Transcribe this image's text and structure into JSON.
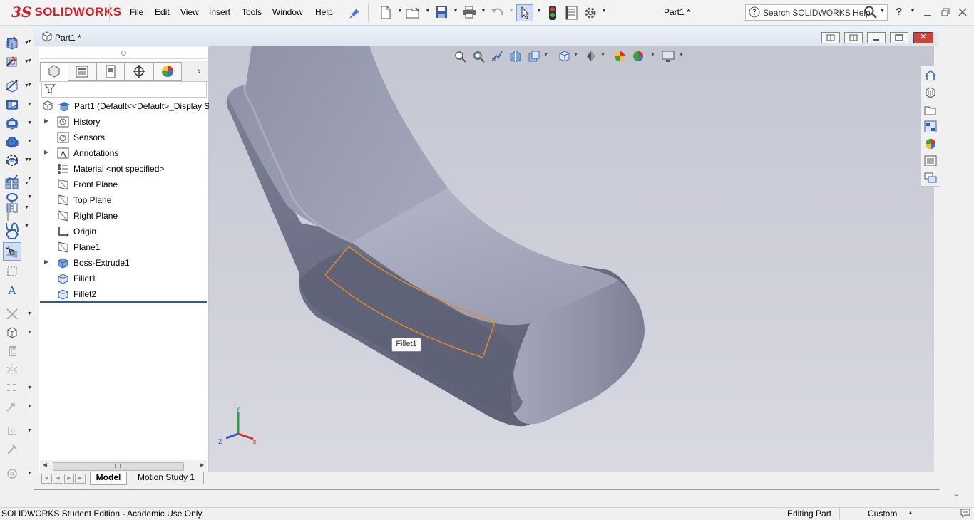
{
  "app": {
    "brand_ds": "3S",
    "brand_name": "SOLIDWORKS"
  },
  "menu": [
    "File",
    "Edit",
    "View",
    "Insert",
    "Tools",
    "Window",
    "Help"
  ],
  "document": {
    "title_top": "Part1 *",
    "window_title": "Part1 *"
  },
  "search": {
    "placeholder": "Search SOLIDWORKS Help"
  },
  "help_glyph": "?",
  "feature_tree": {
    "root": "Part1  (Default<<Default>_Display S",
    "items": [
      {
        "label": "History",
        "expandable": true,
        "icon": "history-icon"
      },
      {
        "label": "Sensors",
        "expandable": false,
        "icon": "sensor-icon"
      },
      {
        "label": "Annotations",
        "expandable": true,
        "icon": "annotation-icon"
      },
      {
        "label": "Material <not specified>",
        "expandable": false,
        "icon": "material-icon"
      },
      {
        "label": "Front Plane",
        "expandable": false,
        "icon": "plane-icon"
      },
      {
        "label": "Top Plane",
        "expandable": false,
        "icon": "plane-icon"
      },
      {
        "label": "Right Plane",
        "expandable": false,
        "icon": "plane-icon"
      },
      {
        "label": "Origin",
        "expandable": false,
        "icon": "origin-icon"
      },
      {
        "label": "Plane1",
        "expandable": false,
        "icon": "plane-icon"
      },
      {
        "label": "Boss-Extrude1",
        "expandable": true,
        "icon": "extrude-icon"
      },
      {
        "label": "Fillet1",
        "expandable": false,
        "icon": "fillet-icon"
      },
      {
        "label": "Fillet2",
        "expandable": false,
        "icon": "fillet-icon"
      }
    ]
  },
  "viewport": {
    "tooltip": "Fillet1",
    "triad": {
      "x": "X",
      "y": "Y",
      "z": "Z"
    }
  },
  "bottom_tabs": {
    "model": "Model",
    "motion": "Motion Study 1"
  },
  "status": {
    "left": "SOLIDWORKS Student Edition - Academic Use Only",
    "mode": "Editing Part",
    "units": "Custom"
  },
  "colors": {
    "brand_red": "#d41f26",
    "selection_orange": "#e58a1f",
    "close_red": "#c9463d"
  }
}
